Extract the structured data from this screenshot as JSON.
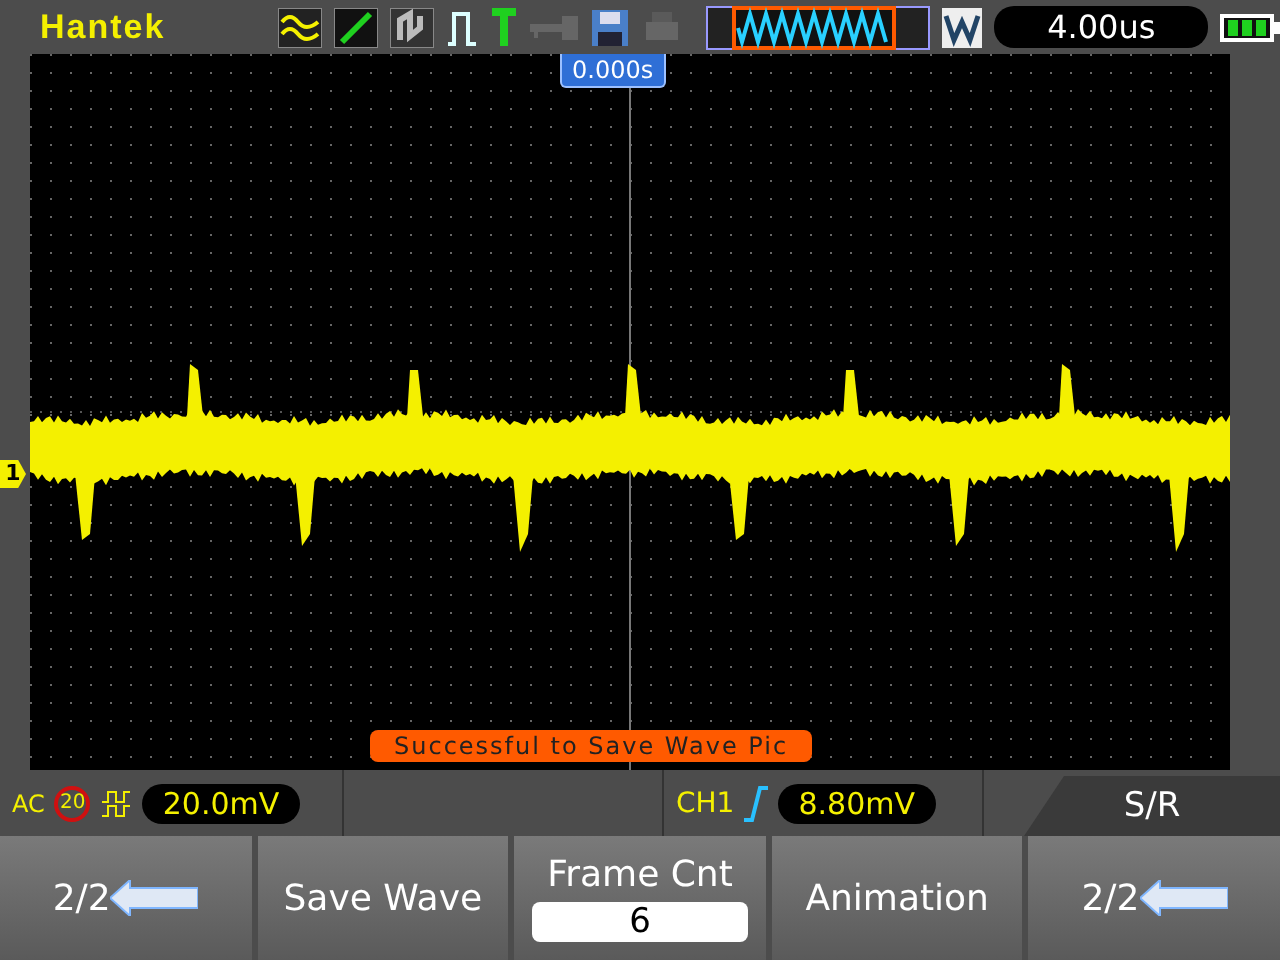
{
  "brand": "Hantek",
  "timebase": "4.00us",
  "trigger_position": "0.000s",
  "channel_marker": "1",
  "status_message": "Successful to Save Wave Pic",
  "channel": {
    "coupling": "AC",
    "bandwidth_limit": "20",
    "scale": "20.0mV"
  },
  "trigger": {
    "source": "CH1",
    "level": "8.80mV"
  },
  "menu_title": "S/R",
  "softkeys": [
    {
      "kind": "nav",
      "label": "2/2"
    },
    {
      "kind": "button",
      "label": "Save Wave"
    },
    {
      "kind": "field",
      "label": "Frame Cnt",
      "value": "6"
    },
    {
      "kind": "button",
      "label": "Animation"
    },
    {
      "kind": "nav",
      "label": "2/2"
    }
  ]
}
